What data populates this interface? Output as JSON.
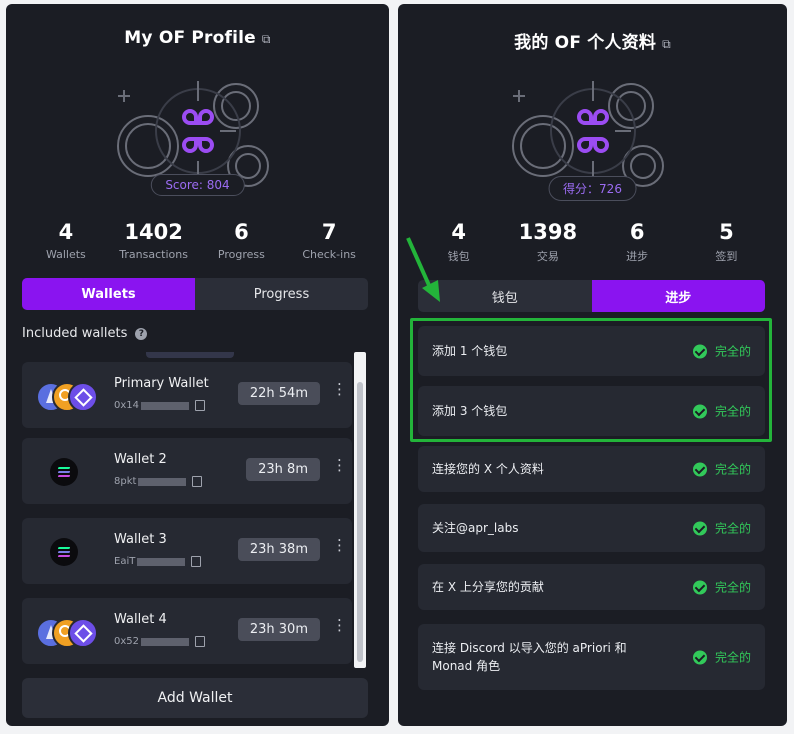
{
  "left": {
    "title": "My OF Profile",
    "score": "Score: 804",
    "stats": [
      {
        "value": "4",
        "label": "Wallets"
      },
      {
        "value": "1402",
        "label": "Transactions"
      },
      {
        "value": "6",
        "label": "Progress"
      },
      {
        "value": "7",
        "label": "Check-ins"
      }
    ],
    "tabs": [
      "Wallets",
      "Progress"
    ],
    "active_tab": "Wallets",
    "included_label": "Included wallets",
    "wallets": [
      {
        "name": "Primary Wallet",
        "addr": "0x14",
        "time": "22h 54m",
        "icons": "eth-gold-monad"
      },
      {
        "name": "Wallet 2",
        "addr": "8pkt",
        "time": "23h 8m",
        "icons": "solana"
      },
      {
        "name": "Wallet 3",
        "addr": "EaiT",
        "time": "23h 38m",
        "icons": "solana"
      },
      {
        "name": "Wallet 4",
        "addr": "0x52",
        "time": "23h 30m",
        "icons": "eth-gold-monad"
      }
    ],
    "add_wallet": "Add Wallet"
  },
  "right": {
    "title": "我的 OF 个人资料",
    "score": "得分：726",
    "stats": [
      {
        "value": "4",
        "label": "钱包"
      },
      {
        "value": "1398",
        "label": "交易"
      },
      {
        "value": "6",
        "label": "进步"
      },
      {
        "value": "5",
        "label": "签到"
      }
    ],
    "tabs": [
      "钱包",
      "进步"
    ],
    "active_tab": "进步",
    "tasks": [
      {
        "label": "添加 1 个钱包",
        "status": "完全的"
      },
      {
        "label": "添加 3 个钱包",
        "status": "完全的"
      },
      {
        "label": "连接您的 X 个人资料",
        "status": "完全的"
      },
      {
        "label": "关注@apr_labs",
        "status": "完全的"
      },
      {
        "label": "在 X 上分享您的贡献",
        "status": "完全的"
      },
      {
        "label": "连接 Discord 以导入您的 aPriori 和 Monad 角色",
        "status": "完全的"
      }
    ]
  },
  "colors": {
    "accent": "#8a14f0",
    "success": "#32c95a",
    "highlight": "#23b43a",
    "panel": "#1b1d24"
  },
  "icons": [
    "external-link-icon",
    "help-icon",
    "copy-icon",
    "kebab-menu-icon",
    "check-circle-icon",
    "arrow-icon",
    "gear-emblem-icon"
  ]
}
